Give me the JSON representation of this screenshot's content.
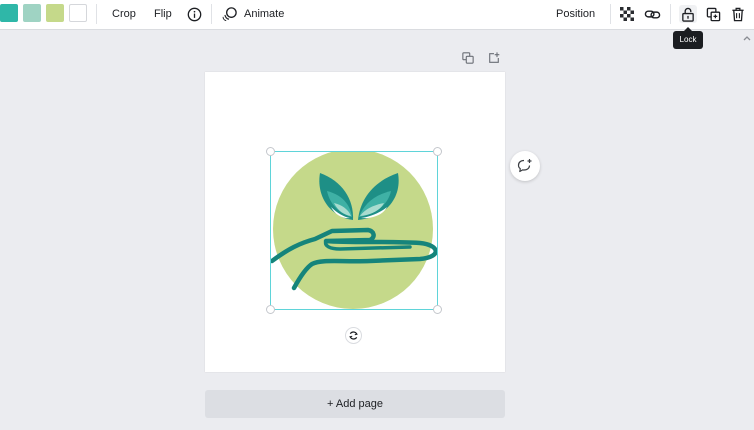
{
  "toolbar": {
    "swatches": [
      {
        "name": "teal",
        "color": "#2fb7a8"
      },
      {
        "name": "mint",
        "color": "#9fd3c3"
      },
      {
        "name": "lime",
        "color": "#c5d98a"
      },
      {
        "name": "white",
        "color": "#ffffff"
      }
    ],
    "crop_label": "Crop",
    "flip_label": "Flip",
    "animate_label": "Animate",
    "position_label": "Position",
    "lock_tooltip": "Lock"
  },
  "canvas": {
    "add_page_label": "+ Add page"
  },
  "graphic": {
    "circle_color": "#c5d98a",
    "stroke_color": "#15847b",
    "leaf_dark": "#1e8f86",
    "leaf_mid": "#3fb1a5",
    "leaf_light": "#a9dccf"
  }
}
